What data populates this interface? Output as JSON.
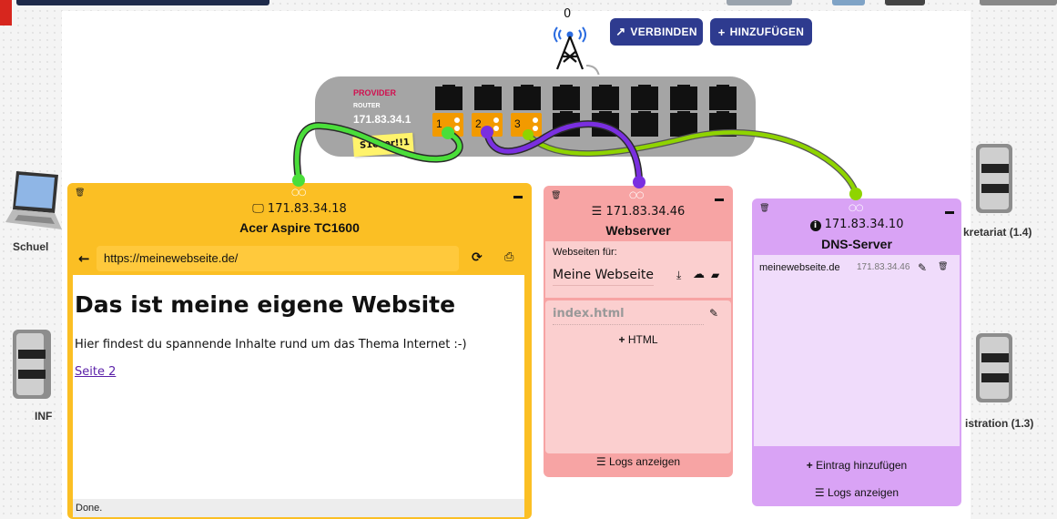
{
  "toolbar": {
    "antenna_count": "0",
    "connect_label": "VERBINDEN",
    "add_label": "HINZUFÜGEN"
  },
  "router": {
    "provider": "PROVIDER",
    "type": "ROUTER",
    "ip": "171.83.34.1",
    "sticky_note": "S1cher!!1",
    "ports": [
      "1",
      "2",
      "3"
    ]
  },
  "devices": {
    "left_laptop_label": "Schuel",
    "left_server_label": "INF",
    "right_server_top_label": "kretariat (1.4)",
    "right_server_bottom_label": "istration (1.3)"
  },
  "browser_panel": {
    "ip": "171.83.34.18",
    "name": "Acer Aspire TC1600",
    "url": "https://meinewebseite.de/",
    "page_heading": "Das ist meine eigene Website",
    "page_text": "Hier findest du spannende Inhalte rund um das Thema Internet :-)",
    "page_link": "Seite 2",
    "status": "Done."
  },
  "webserver_panel": {
    "ip": "171.83.34.46",
    "name": "Webserver",
    "sites_label": "Webseiten für:",
    "site_name": "Meine Webseite",
    "file_name": "index.html",
    "add_html_label": "HTML",
    "logs_label": "Logs anzeigen"
  },
  "dns_panel": {
    "ip": "171.83.34.10",
    "name": "DNS-Server",
    "entries": [
      {
        "domain": "meinewebseite.de",
        "ip": "171.83.34.46"
      }
    ],
    "add_entry_label": "Eintrag hinzufügen",
    "logs_label": "Logs anzeigen"
  },
  "colors": {
    "browser_panel": "#fbbf24",
    "webserver_panel": "#f7a4a4",
    "dns_panel": "#d9a3f5",
    "button": "#2e3b8f",
    "cable_green": "#4ade3a",
    "cable_purple": "#7a2fe0",
    "cable_lime": "#8fd400",
    "port_orange": "#f29a00"
  }
}
